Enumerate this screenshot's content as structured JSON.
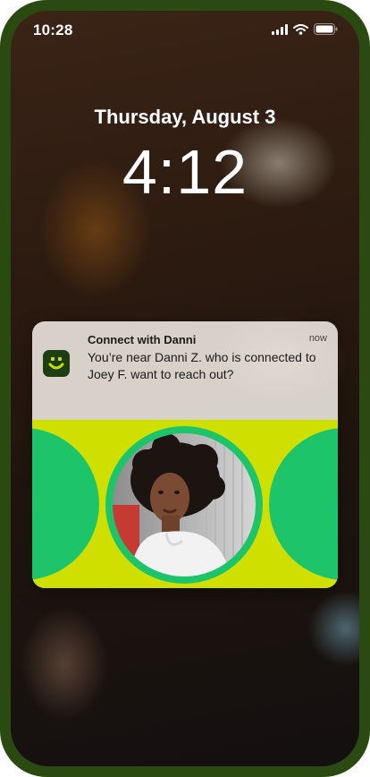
{
  "status_bar": {
    "time": "10:28",
    "icons": [
      "signal-icon",
      "wifi-icon",
      "battery-icon"
    ]
  },
  "lock_screen": {
    "date": "Thursday, August 3",
    "time": "4:12"
  },
  "notification": {
    "app_icon": "smiley-icon",
    "title": "Connect with Danni",
    "timestamp": "now",
    "message": "You’re near Danni Z. who is connected to Joey F. want to reach out?"
  },
  "colors": {
    "frame": "#2a4a12",
    "lime": "#cfe000",
    "green": "#1ec46a",
    "app_icon_bg": "#1e3d10"
  }
}
